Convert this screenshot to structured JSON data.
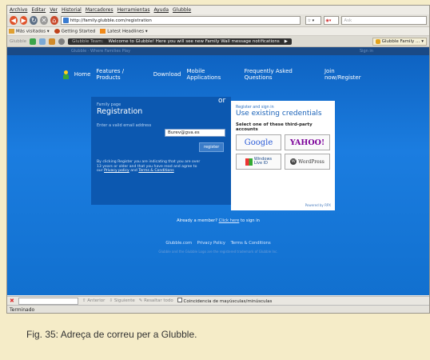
{
  "browser": {
    "menu": [
      "Archivo",
      "Editar",
      "Ver",
      "Historial",
      "Marcadores",
      "Herramientas",
      "Ayuda",
      "Glubble"
    ],
    "url": "http://family.glubble.com/registration",
    "search_placeholder": "Ask",
    "bookmarks": [
      "Más visitados",
      "Getting Started",
      "Latest Headlines"
    ],
    "glubble_toolbar": {
      "brand": "Glubble",
      "team": "Glubble Team:",
      "message": "Welcome to Glubble! Here you will see new Family Wall message notifications",
      "family_button": "Glubble Family ..."
    },
    "tabstrip": {
      "left": "Glubble · Where Families Play",
      "right": "Sign in"
    },
    "status": "Terminado",
    "findbar": {
      "previous": "Anterior",
      "next": "Siguiente",
      "highlight": "Resaltar todo",
      "match_case": "Coincidencia de mayúsculas/minúsculas"
    }
  },
  "page": {
    "nav": [
      "Home",
      "Features / Products",
      "Download",
      "Mobile Applications",
      "Frequently Asked Questions"
    ],
    "join": "Join now/Register",
    "left": {
      "small": "Family page",
      "title": "Registration",
      "email_label": "Enter a valid email address",
      "email_value": "Burev@gva.es",
      "register": "register",
      "disclaimer": "By clicking Register you are indicating that you are over 13 years or older and that you have read and agree to our",
      "privacy": "Privacy policy",
      "and": "and",
      "terms": "Terms & Conditions"
    },
    "or": "or",
    "right": {
      "small": "Register and sign in",
      "title": "Use existing credentials",
      "select": "Select one of these third-party accounts",
      "providers": {
        "google": "Google",
        "yahoo": "YAHOO!",
        "windows_top": "Windows",
        "windows_bottom": "Live ID",
        "wordpress": "WordPress"
      },
      "powered": "Powered by RPX"
    },
    "member_text": "Already a member?",
    "member_link": "Click here",
    "member_suffix": "to sign in",
    "footer_links": [
      "Glubble.com",
      "Privacy Policy",
      "Terms & Conditions"
    ],
    "footer_copy": "Glubble and the Glubble Logo are the registered trademark of Glubble Inc."
  },
  "caption": "Fig. 35: Adreça de correu per a Glubble."
}
